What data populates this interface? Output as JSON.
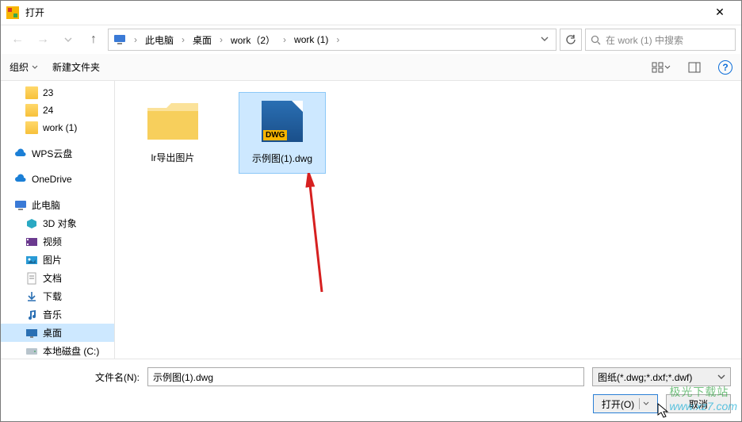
{
  "title": "打开",
  "breadcrumb": {
    "items": [
      "此电脑",
      "桌面",
      "work（2）",
      "work (1)"
    ]
  },
  "search": {
    "placeholder": "在 work (1) 中搜索"
  },
  "toolbar": {
    "organize": "组织",
    "new_folder": "新建文件夹"
  },
  "sidebar": {
    "items": [
      {
        "label": "23",
        "icon": "folder",
        "indent": true
      },
      {
        "label": "24",
        "icon": "folder",
        "indent": true
      },
      {
        "label": "work (1)",
        "icon": "folder",
        "indent": true
      },
      {
        "label": "WPS云盘",
        "icon": "cloud"
      },
      {
        "label": "OneDrive",
        "icon": "cloud"
      },
      {
        "label": "此电脑",
        "icon": "pc"
      },
      {
        "label": "3D 对象",
        "icon": "obj3d",
        "indent": true
      },
      {
        "label": "视频",
        "icon": "video",
        "indent": true
      },
      {
        "label": "图片",
        "icon": "pic",
        "indent": true
      },
      {
        "label": "文档",
        "icon": "doc",
        "indent": true
      },
      {
        "label": "下载",
        "icon": "down",
        "indent": true
      },
      {
        "label": "音乐",
        "icon": "music",
        "indent": true
      },
      {
        "label": "桌面",
        "icon": "desk",
        "indent": true,
        "active": true
      },
      {
        "label": "本地磁盘 (C:)",
        "icon": "disk",
        "indent": true
      }
    ]
  },
  "files": [
    {
      "name": "lr导出图片",
      "type": "folder"
    },
    {
      "name": "示例图(1).dwg",
      "type": "dwg",
      "selected": true
    }
  ],
  "footer": {
    "filename_label": "文件名(N):",
    "filename_value": "示例图(1).dwg",
    "filter_label": "图纸(*.dwg;*.dxf;*.dwf)",
    "open_label": "打开(O)",
    "cancel_label": "取消"
  },
  "watermark": {
    "cn": "极光下载站",
    "en": "www.xz7.com"
  }
}
